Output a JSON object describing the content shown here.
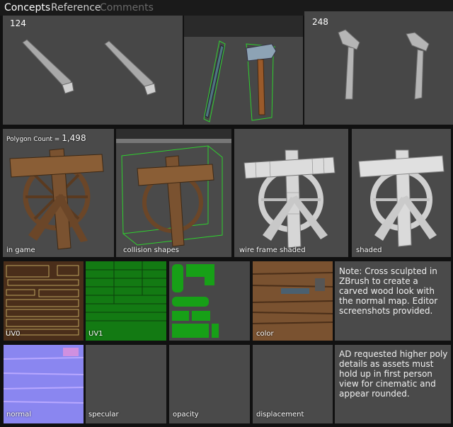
{
  "tabs": {
    "concepts": "Concepts",
    "reference": "Reference",
    "comments": "Comments"
  },
  "top_row": {
    "left_count": "124",
    "right_count": "248"
  },
  "renders": {
    "polygon_label": "Polygon Count = ",
    "polygon_value": "1,498",
    "in_game": "in game",
    "collision": "collision shapes",
    "wireframe": "wire frame shaded",
    "shaded": "shaded"
  },
  "textures": {
    "uv0": "UV0",
    "uv1": "UV1",
    "color": "color",
    "normal": "normal",
    "specular": "specular",
    "opacity": "opacity",
    "displacement": "displacement"
  },
  "notes": {
    "note1": "Note: Cross sculpted in ZBrush to create a carved wood look with the normal map. Editor screenshots provided.",
    "note2": "AD requested higher poly details as assets must hold up in first person view for cinematic and appear rounded."
  },
  "colors": {
    "panel_bg": "#4a4a4a",
    "wood": "#7a5230",
    "uv_green": "#169a16",
    "normal_blue": "#8080ff",
    "wire_green": "#2fd02f"
  }
}
